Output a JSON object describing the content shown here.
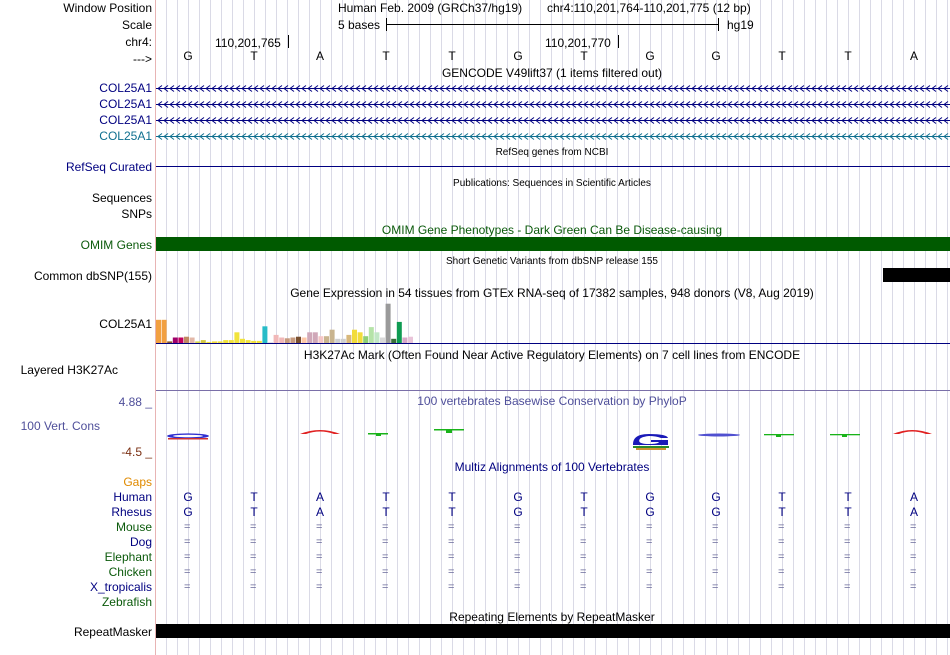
{
  "header": {
    "window_position_label": "Window Position",
    "scale_label": "Scale",
    "chrom_label": "chr4:",
    "strand_label": "--->",
    "assembly": "Human Feb. 2009 (GRCh37/hg19)",
    "position": "chr4:110,201,764-110,201,775 (12 bp)",
    "scale_text": "5 bases",
    "db": "hg19",
    "coord1": "110,201,765",
    "coord2": "110,201,770"
  },
  "bases": [
    "G",
    "T",
    "A",
    "T",
    "T",
    "G",
    "T",
    "G",
    "G",
    "T",
    "T",
    "A"
  ],
  "tracks": {
    "gencode_title": "GENCODE V49lift37 (1 items filtered out)",
    "gencode_genes": [
      "COL25A1",
      "COL25A1",
      "COL25A1",
      "COL25A1"
    ],
    "refseq_title": "RefSeq genes from NCBI",
    "refseq_label": "RefSeq Curated",
    "pubs_title": "Publications: Sequences in Scientific Articles",
    "pubs_label1": "Sequences",
    "pubs_label2": "SNPs",
    "omim_title": "OMIM Gene Phenotypes - Dark Green Can Be Disease-causing",
    "omim_label": "OMIM Genes",
    "dbsnp_title": "Short Genetic Variants from dbSNP release 155",
    "dbsnp_label": "Common dbSNP(155)",
    "gtex_title": "Gene Expression in 54 tissues from GTEx RNA-seq of 17382 samples, 948 donors (V8, Aug 2019)",
    "gtex_label": "COL25A1",
    "h3k27_title": "H3K27Ac Mark (Often Found Near Active Regulatory Elements) on 7 cell lines from ENCODE",
    "h3k27_label": "Layered H3K27Ac",
    "cons_title": "100 vertebrates Basewise Conservation by PhyloP",
    "cons_label": "100 Vert. Cons",
    "cons_max": "4.88 _",
    "cons_min": "-4.5 _",
    "multiz_title": "Multiz Alignments of 100 Vertebrates",
    "gaps_label": "Gaps",
    "species": [
      "Human",
      "Rhesus",
      "Mouse",
      "Dog",
      "Elephant",
      "Chicken",
      "X_tropicalis",
      "Zebrafish"
    ],
    "rmsk_title": "Repeating Elements by RepeatMasker",
    "rmsk_label": "RepeatMasker"
  },
  "gtex_values": [
    {
      "color": "#f2a041",
      "v": 0.93
    },
    {
      "color": "#f2a041",
      "v": 0.93
    },
    {
      "color": "#8a5a2b",
      "v": 0.1
    },
    {
      "color": "#a0006a",
      "v": 0.25
    },
    {
      "color": "#c1005d",
      "v": 0.25
    },
    {
      "color": "#c08a63",
      "v": 0.28
    },
    {
      "color": "#e3b8a8",
      "v": 0.25
    },
    {
      "color": "#d8d84c",
      "v": 0.1
    },
    {
      "color": "#d2c740",
      "v": 0.15
    },
    {
      "color": "#f0e23a",
      "v": 0.08
    },
    {
      "color": "#f3de3b",
      "v": 0.1
    },
    {
      "color": "#f0e23a",
      "v": 0.1
    },
    {
      "color": "#f0e23a",
      "v": 0.15
    },
    {
      "color": "#f0e23a",
      "v": 0.15
    },
    {
      "color": "#f1e33c",
      "v": 0.45
    },
    {
      "color": "#f1e33c",
      "v": 0.2
    },
    {
      "color": "#f1e33c",
      "v": 0.15
    },
    {
      "color": "#f1e33c",
      "v": 0.12
    },
    {
      "color": "#f1e33c",
      "v": 0.12
    },
    {
      "color": "#28bcc8",
      "v": 0.68
    },
    {
      "color": "#a6a6a6",
      "v": 0.05
    },
    {
      "color": "#f1b8b8",
      "v": 0.35
    },
    {
      "color": "#f1b8b8",
      "v": 0.25
    },
    {
      "color": "#c79a7e",
      "v": 0.22
    },
    {
      "color": "#c79a7e",
      "v": 0.25
    },
    {
      "color": "#7a5030",
      "v": 0.28
    },
    {
      "color": "#ffc9a8",
      "v": 0.25
    },
    {
      "color": "#d0a8b8",
      "v": 0.45
    },
    {
      "color": "#d0a8b8",
      "v": 0.45
    },
    {
      "color": "#f5c6c6",
      "v": 0.3
    },
    {
      "color": "#c9b48e",
      "v": 0.3
    },
    {
      "color": "#c9b48e",
      "v": 0.55
    },
    {
      "color": "#d0d0d0",
      "v": 0.2
    },
    {
      "color": "#d0d0d0",
      "v": 0.2
    },
    {
      "color": "#d8b87c",
      "v": 0.35
    },
    {
      "color": "#f2dc3b",
      "v": 0.55
    },
    {
      "color": "#f2dc3b",
      "v": 0.45
    },
    {
      "color": "#8fcf75",
      "v": 0.3
    },
    {
      "color": "#b5e3a8",
      "v": 0.65
    },
    {
      "color": "#c2e7c6",
      "v": 0.45
    },
    {
      "color": "#d9d9d9",
      "v": 0.25
    },
    {
      "color": "#9a9a9a",
      "v": 1.55
    },
    {
      "color": "#3a6f3a",
      "v": 0.2
    },
    {
      "color": "#0f9b52",
      "v": 0.85
    },
    {
      "color": "#d7a8c8",
      "v": 0.25
    },
    {
      "color": "#e9c4d9",
      "v": 0.28
    }
  ],
  "colors": {
    "gene_navy": "#000080",
    "gene_teal": "#0e6f8f",
    "omim": "#005a00",
    "black": "#000000"
  }
}
